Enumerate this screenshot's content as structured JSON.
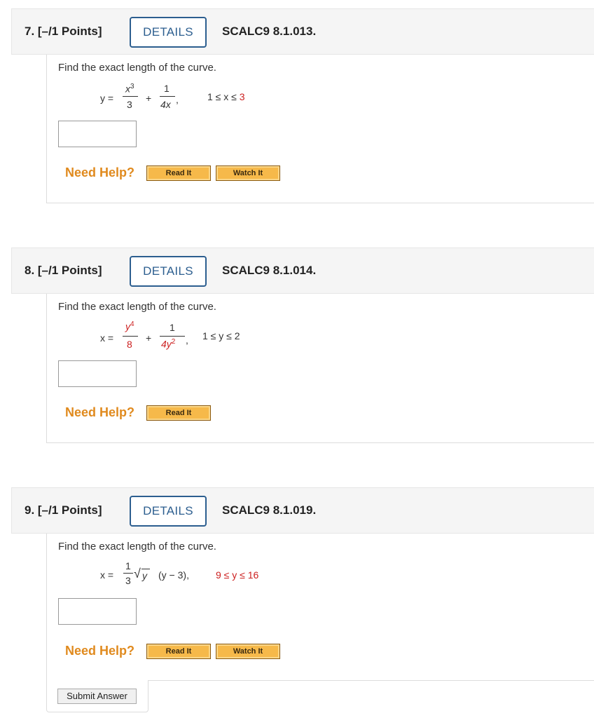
{
  "questions": [
    {
      "number": "7. [–/1 Points]",
      "details_label": "DETAILS",
      "code": "SCALC9 8.1.013.",
      "prompt": "Find the exact length of the curve.",
      "math": {
        "lhs": "y =",
        "num1": "x",
        "num1_exp": "3",
        "den1": "3",
        "plus": "+",
        "num2": "1",
        "den2": "4x",
        "comma": ",",
        "range_prefix": "1 ≤ x ≤ ",
        "range_value": "3"
      },
      "need_help": "Need Help?",
      "buttons": [
        "Read It",
        "Watch It"
      ]
    },
    {
      "number": "8. [–/1 Points]",
      "details_label": "DETAILS",
      "code": "SCALC9 8.1.014.",
      "prompt": "Find the exact length of the curve.",
      "math": {
        "lhs": "x =",
        "num1": "y",
        "num1_exp": "4",
        "den1": "8",
        "plus": "+",
        "num2": "1",
        "den2": "4y",
        "den2_exp": "2",
        "comma": ",",
        "range": "1 ≤ y ≤ 2"
      },
      "need_help": "Need Help?",
      "buttons": [
        "Read It"
      ]
    },
    {
      "number": "9. [–/1 Points]",
      "details_label": "DETAILS",
      "code": "SCALC9 8.1.019.",
      "prompt": "Find the exact length of the curve.",
      "math": {
        "lhs": "x =",
        "num": "1",
        "den": "3",
        "radical": "√",
        "radicand": "y",
        "rest": "(y − 3),",
        "range": "9 ≤ y ≤ 16"
      },
      "need_help": "Need Help?",
      "buttons": [
        "Read It",
        "Watch It"
      ]
    }
  ],
  "submit_label": "Submit Answer",
  "colors": {
    "accent_blue": "#2c5e8f",
    "help_orange": "#e08a1e",
    "param_red": "#cc1f1f"
  }
}
